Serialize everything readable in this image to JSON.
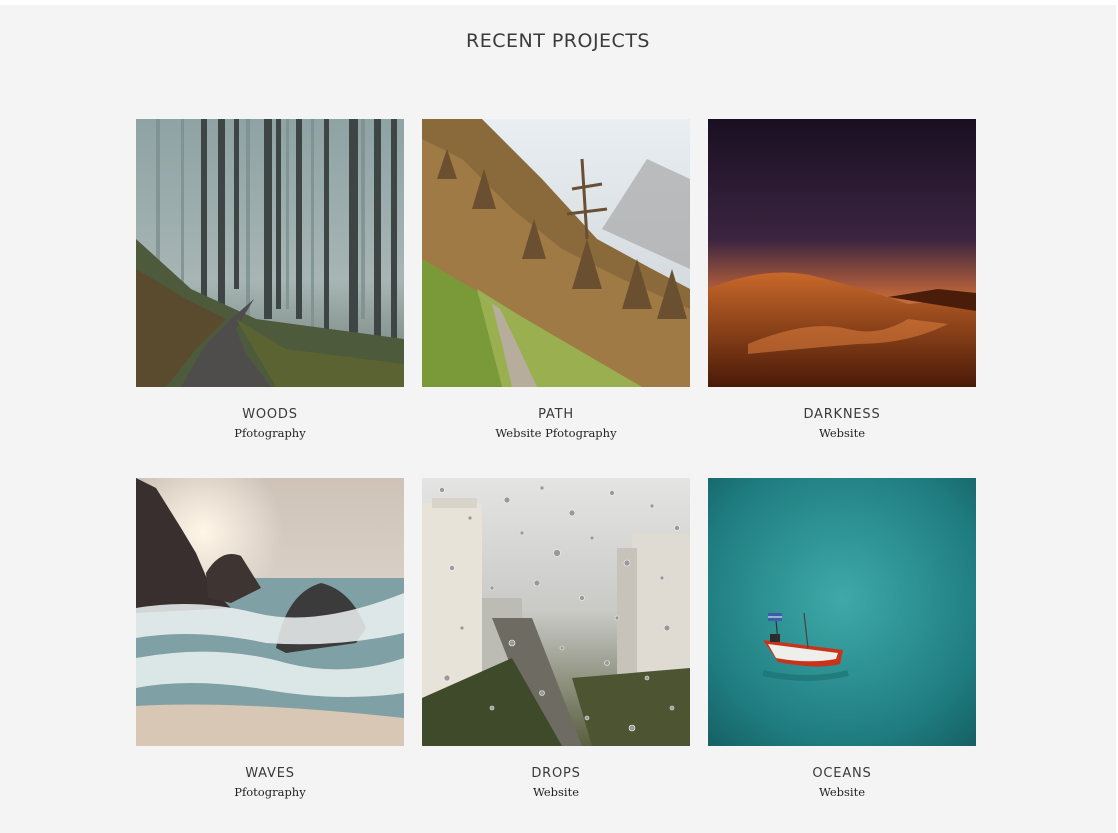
{
  "section": {
    "title": "RECENT PROJECTS"
  },
  "projects": [
    {
      "title": "WOODS",
      "category": "Pfotography",
      "image": "misty forest path"
    },
    {
      "title": "PATH",
      "category": "Website Pfotography",
      "image": "mountain trail with larch trees"
    },
    {
      "title": "DARKNESS",
      "category": "Website",
      "image": "desert dune at dusk"
    },
    {
      "title": "WAVES",
      "category": "Pfotography",
      "image": "rocky coast with waves"
    },
    {
      "title": "DROPS",
      "category": "Website",
      "image": "raindrops on window over city"
    },
    {
      "title": "OCEANS",
      "category": "Website",
      "image": "red boat on turquoise sea"
    }
  ],
  "colors": {
    "background": "#f4f4f4",
    "title": "#3a3a3a",
    "category": "#222222"
  }
}
